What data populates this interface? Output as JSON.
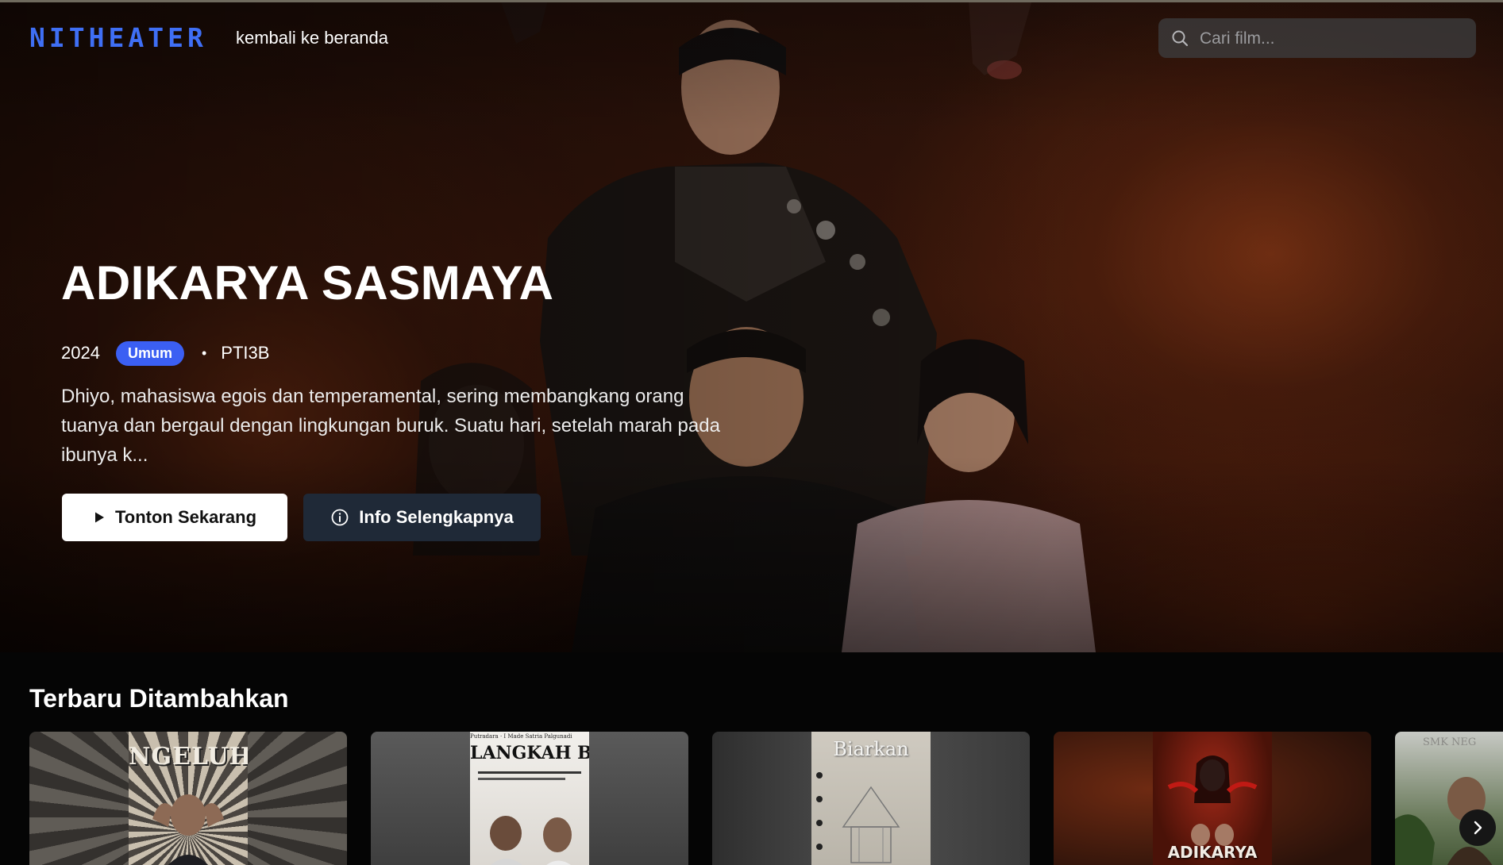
{
  "nav": {
    "logo": "NITHEATER",
    "home_link": "kembali ke beranda",
    "search_placeholder": "Cari film..."
  },
  "hero": {
    "title": "ADIKARYA SASMAYA",
    "year": "2024",
    "badge": "Umum",
    "separator": "•",
    "class_name": "PTI3B",
    "description": "Dhiyo, mahasiswa egois dan temperamental, sering membangkang orang tuanya dan bergaul dengan lingkungan buruk. Suatu hari, setelah marah pada ibunya k...",
    "watch_label": "Tonton Sekarang",
    "info_label": "Info Selengkapnya"
  },
  "section": {
    "title": "Terbaru Ditambahkan",
    "cards": [
      {
        "poster_title": "NGELUH",
        "poster_sub": ""
      },
      {
        "poster_title": "LANGKAH BARU",
        "poster_sub": "Putradara · I Made Satria Palgunadi"
      },
      {
        "poster_title": "Biarkan",
        "poster_sub": ""
      },
      {
        "poster_title": "ADIKARYA",
        "poster_sub": ""
      },
      {
        "poster_title": "SMK NEG",
        "poster_sub": ""
      }
    ]
  },
  "colors": {
    "accent": "#3f6ff5",
    "badge": "#3b5ff3",
    "info_button": "#1f2937"
  },
  "icons": {
    "search": "search-icon",
    "play": "play-icon",
    "info": "info-icon",
    "next": "chevron-right-icon"
  }
}
